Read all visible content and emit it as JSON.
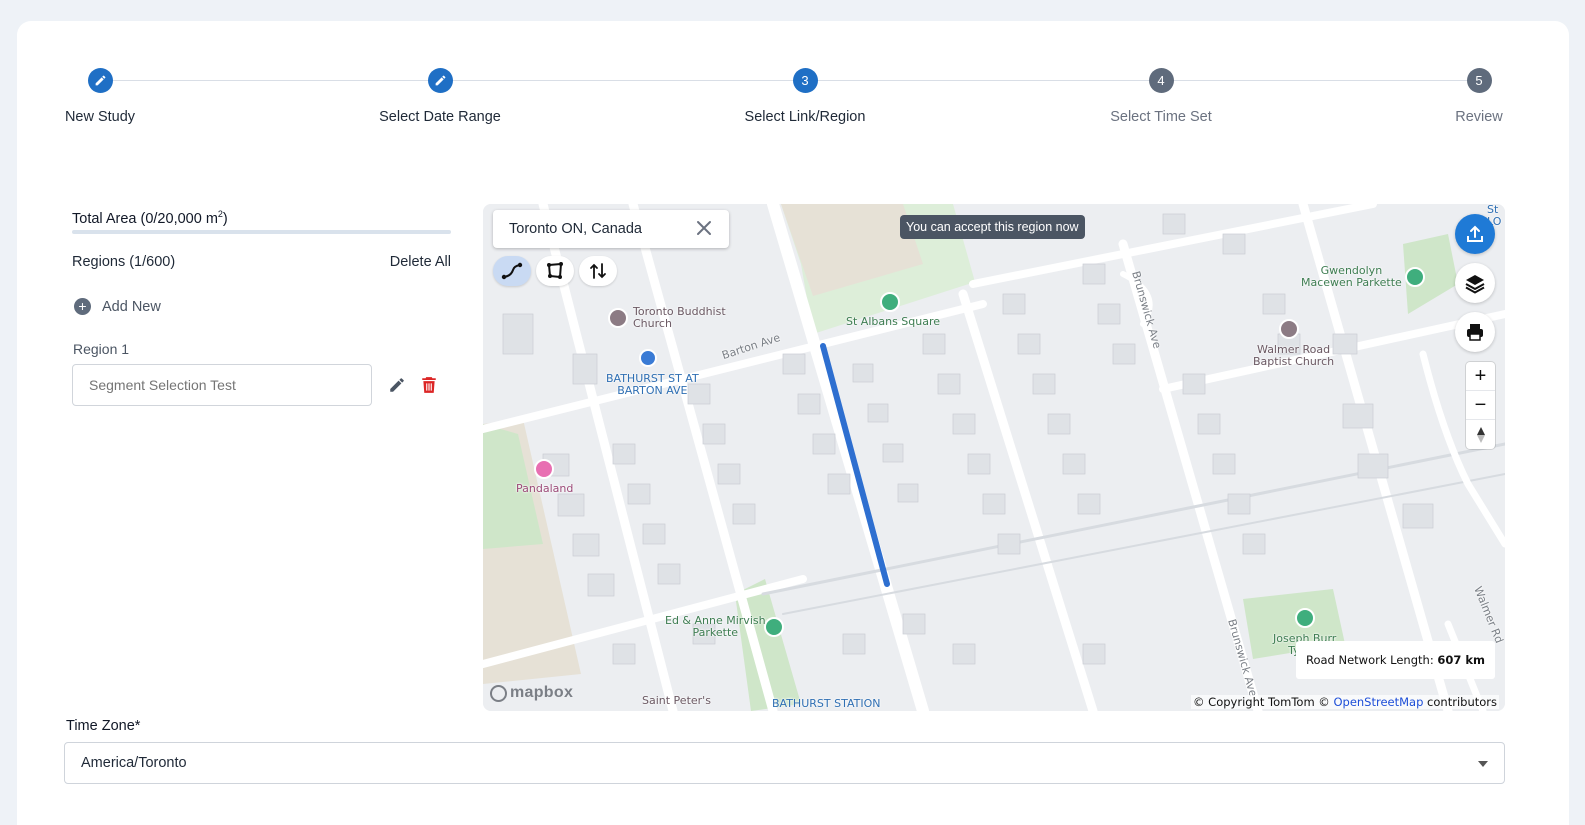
{
  "stepper": {
    "steps": [
      {
        "label": "New Study",
        "marker": "edit-icon",
        "state": "done"
      },
      {
        "label": "Select Date Range",
        "marker": "edit-icon",
        "state": "done"
      },
      {
        "label": "Select Link/Region",
        "marker": "3",
        "state": "current"
      },
      {
        "label": "Select Time Set",
        "marker": "4",
        "state": "pending"
      },
      {
        "label": "Review",
        "marker": "5",
        "state": "pending"
      }
    ]
  },
  "left_panel": {
    "total_area_prefix": "Total Area (0/20,000 m",
    "total_area_sup": "2",
    "total_area_suffix": ")",
    "regions_label": "Regions (1/600)",
    "delete_all": "Delete All",
    "add_new": "Add New",
    "region_name": "Region 1",
    "region_input_placeholder": "Segment Selection Test",
    "edit_icon": "pencil-icon",
    "delete_icon": "trash-icon",
    "delete_color": "#dc2626"
  },
  "map": {
    "search_value": "Toronto ON, Canada",
    "tooltip": "You can accept this region now",
    "tools": [
      "line-draw-icon",
      "polygon-draw-icon",
      "swap-direction-icon"
    ],
    "buttons": [
      "upload-icon",
      "layers-icon",
      "print-icon"
    ],
    "zoom_in": "+",
    "zoom_out": "−",
    "compass": "compass-icon",
    "road_network_label": "Road Network Length:",
    "road_network_value": "607 km",
    "attribution_prefix": "© Copyright TomTom © ",
    "attribution_link": "OpenStreetMap",
    "attribution_suffix": " contributors",
    "logo": "mapbox",
    "labels": {
      "buddhist": "Toronto Buddhist\nChurch",
      "st_albans": "St Albans Square",
      "bathurst_stop": "BATHURST ST AT\nBARTON AVE",
      "barton": "Barton Ave",
      "pandaland": "Pandaland",
      "gwendolyn": "Gwendolyn\nMacewen Parkette",
      "walmer": "Walmer Road\nBaptist Church",
      "brunswick_top": "Brunswick Ave",
      "brunswick_bottom": "Brunswick Ave",
      "ed_anne": "Ed & Anne Mirvish\nParkette",
      "joseph": "Joseph Burr\nTyrrell",
      "saint_peters": "Saint Peter's",
      "bathurst_station": "BATHURST STATION",
      "walmer_rd": "Walmer Rd",
      "corner": "St\nLO"
    },
    "accent": "#1f7ad6",
    "segment_color": "#2e6fd0"
  },
  "timezone": {
    "label": "Time Zone*",
    "value": "America/Toronto"
  }
}
